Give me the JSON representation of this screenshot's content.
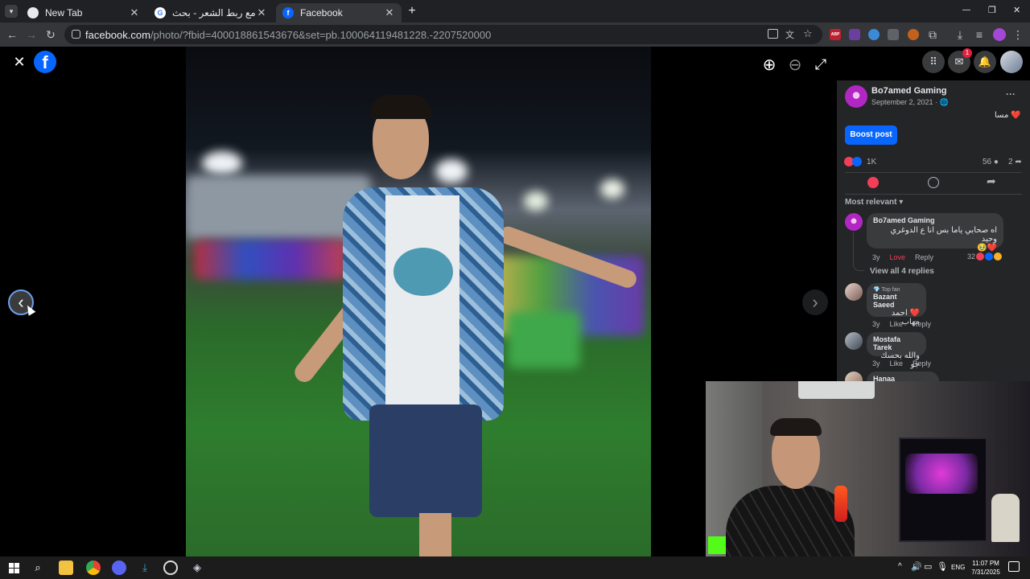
{
  "browser": {
    "tabs": [
      {
        "title": "New Tab",
        "active": false
      },
      {
        "title": "دقن مع ربط الشعر - بحث Google",
        "active": false
      },
      {
        "title": "Facebook",
        "active": true
      }
    ],
    "new_tab_symbol": "+",
    "url_host": "facebook.com",
    "url_path": "/photo/?fbid=400018861543676&set=pb.100064119481228.-2207520000",
    "extension_badge": "ABP",
    "window_controls": {
      "minimize": "—",
      "restore": "❐",
      "close": "✕"
    }
  },
  "viewer": {
    "close_symbol": "✕",
    "logo_letter": "f",
    "zoom_in_symbol": "⊕",
    "zoom_out_symbol": "⊖",
    "fullscreen_symbol": "⤢",
    "prev_symbol": "‹",
    "next_symbol": "›"
  },
  "fb_header": {
    "messenger_badge": "1"
  },
  "post": {
    "author": "Bo7amed Gaming",
    "date": "September 2, 2021 · ",
    "options": "···",
    "caption": "مسا ❤️",
    "boost_label": "Boost post",
    "reactions_count": "1K",
    "comments_count": "56",
    "shares_count": "2",
    "sort_label": "Most relevant"
  },
  "comments": [
    {
      "name": "Bo7amed Gaming",
      "text": "اه صحابي ياما بس انا ع الدوغري وحيد",
      "emoji": "❤️🥹",
      "age": "3y",
      "action1": "Love",
      "action2": "Reply",
      "reaction_count": "32",
      "view_replies": "View all 4 replies"
    },
    {
      "badge": "Top fan",
      "name": "Bazant Saeed",
      "text": "❤️ احمد مهاب",
      "age": "3y",
      "action1": "Like",
      "action2": "Reply"
    },
    {
      "name": "Mostafa Tarek",
      "text": "والله بحسك جو",
      "age": "3y",
      "action1": "Like",
      "action2": "Reply"
    },
    {
      "name": "Hanaa AbdAlhamed"
    }
  ],
  "taskbar": {
    "language": "ENG",
    "time": "11:07 PM",
    "date": "7/31/2025"
  },
  "colors": {
    "fb_blue": "#0866ff",
    "love_red": "#f33e58",
    "panel_bg": "#242526"
  }
}
